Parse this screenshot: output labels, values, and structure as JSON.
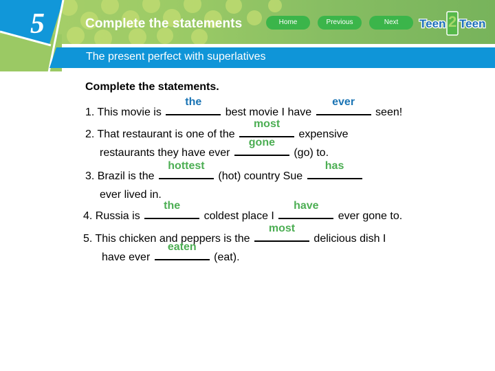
{
  "header": {
    "chapter_number": "5",
    "title": "Complete the statements",
    "subtitle": "The present perfect with superlatives",
    "nav": [
      {
        "label": "Home"
      },
      {
        "label": "Previous"
      },
      {
        "label": "Next"
      }
    ],
    "logo_text": "Teen 2 Teen"
  },
  "colors": {
    "banner_green": "#88be63",
    "tab_blue": "#1197d9",
    "nav_button_green": "#3bb54a",
    "answer_blue": "#1a74b4",
    "answer_green": "#4cae53"
  },
  "content": {
    "instructions": "Complete the statements.",
    "items": [
      {
        "parts": [
          "1. This movie is ",
          " best movie I have ",
          " seen!"
        ],
        "answers": [
          "the",
          "ever"
        ]
      },
      {
        "line1": [
          "2. That restaurant is one of the ",
          " expensive"
        ],
        "line2": [
          "restaurants they have ever ",
          " (go) to."
        ],
        "answers": [
          "most",
          "gone"
        ]
      },
      {
        "line1": [
          "3. Brazil is the ",
          " (hot) country Sue ",
          ""
        ],
        "line2": [
          "ever lived in."
        ],
        "answers": [
          "hottest",
          "has"
        ]
      },
      {
        "parts": [
          "4. Russia is ",
          " coldest place I ",
          " ever gone to."
        ],
        "answers": [
          "the",
          "have"
        ]
      },
      {
        "line1": [
          "5. This chicken and peppers is the ",
          " delicious dish I"
        ],
        "line2": [
          "have ever ",
          " (eat)."
        ],
        "answers": [
          "most",
          "eaten"
        ]
      }
    ]
  }
}
